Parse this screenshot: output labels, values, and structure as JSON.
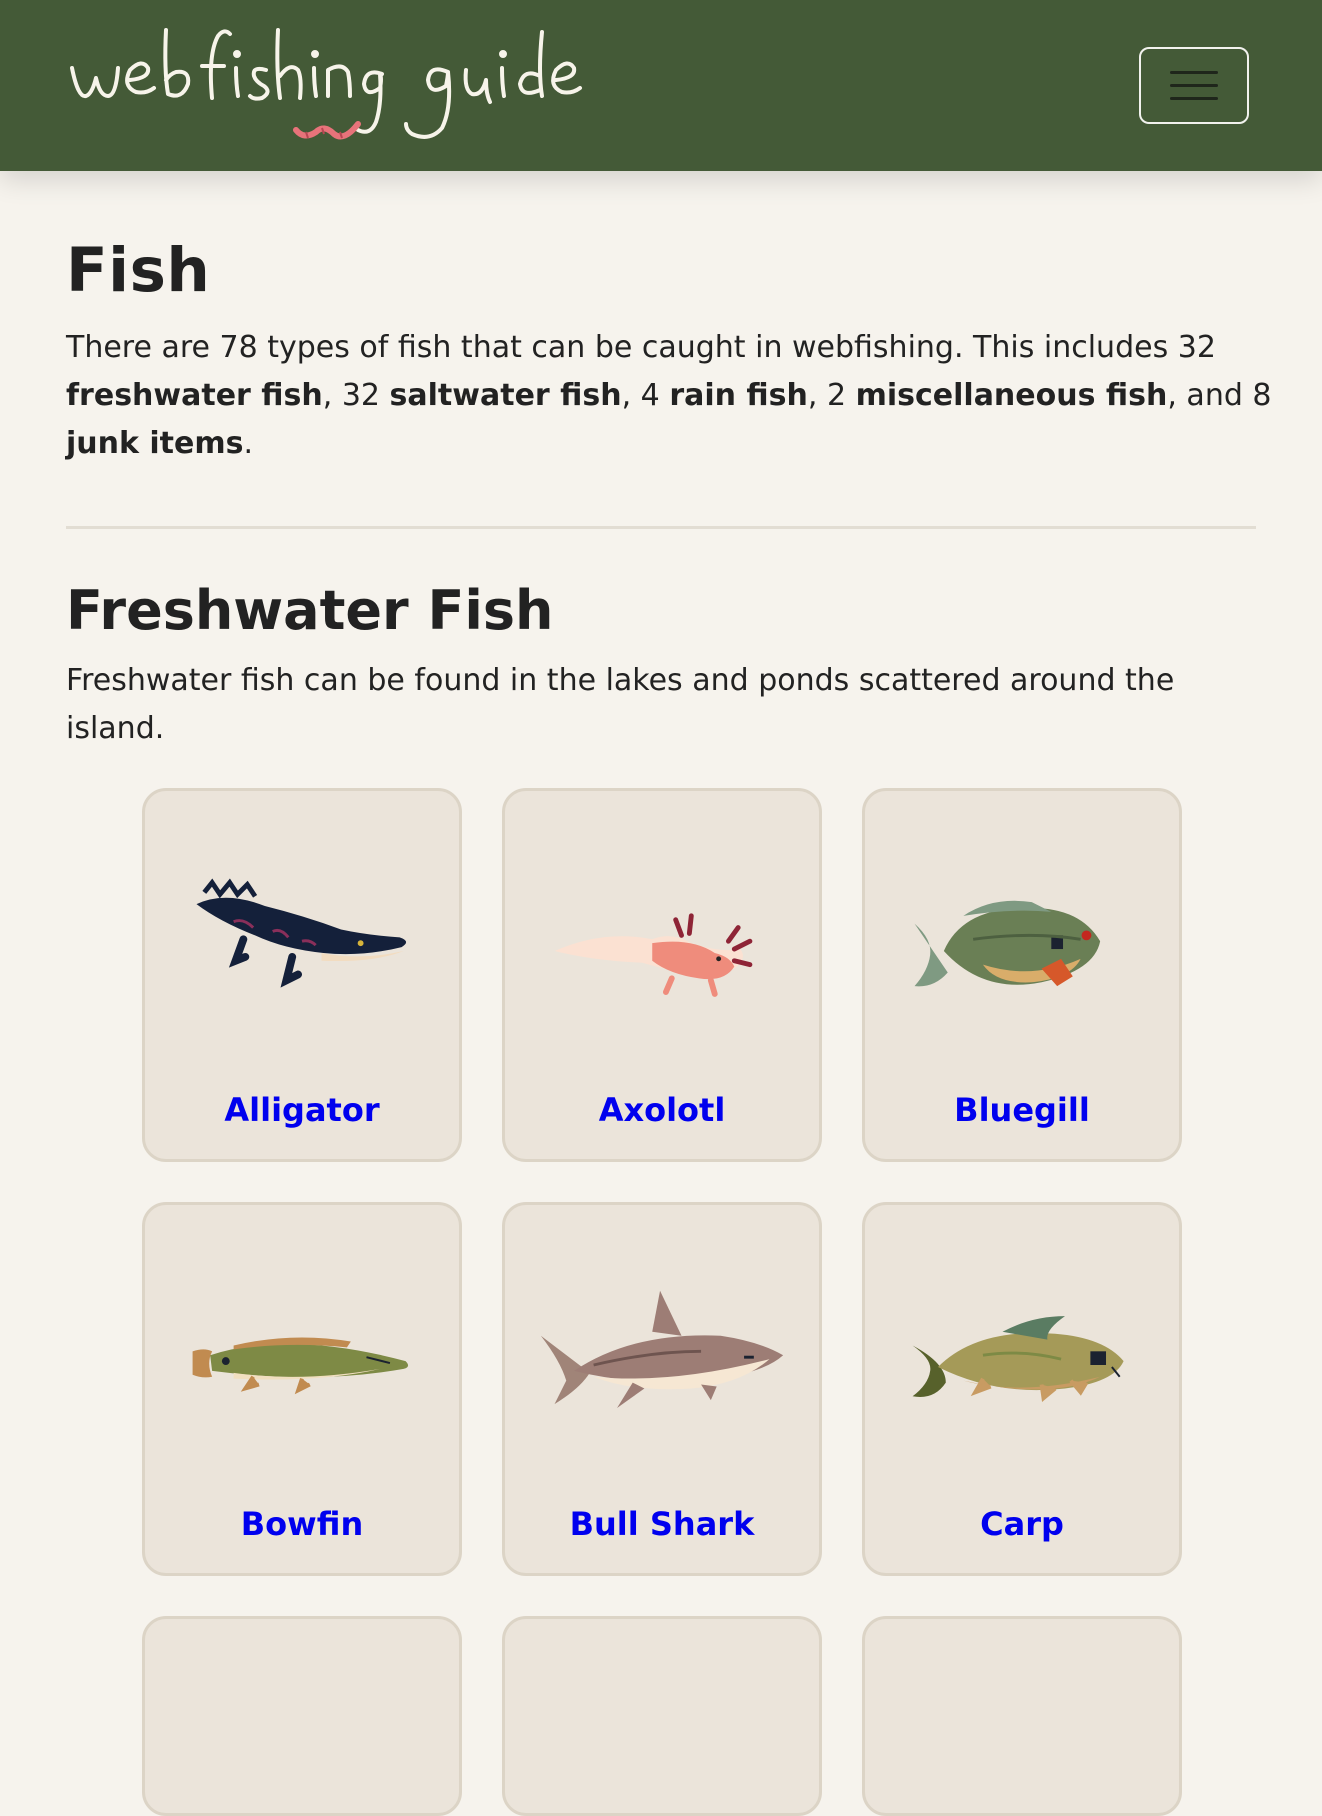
{
  "header": {
    "brand_logo_text": "webfishing guide"
  },
  "page": {
    "title": "Fish",
    "intro": {
      "t1": "There are 78 types of fish that can be caught in webfishing. This includes 32 ",
      "b1": "freshwater fish",
      "t2": ", 32 ",
      "b2": "saltwater fish",
      "t3": ", 4 ",
      "b3": "rain fish",
      "t4": ", 2 ",
      "b4": "miscellaneous fish",
      "t5": ", and 8 ",
      "b5": "junk items",
      "t6": "."
    }
  },
  "freshwater": {
    "title": "Freshwater Fish",
    "description": "Freshwater fish can be found in the lakes and ponds scattered around the island.",
    "fish": [
      {
        "name": "Alligator",
        "icon": "alligator-icon"
      },
      {
        "name": "Axolotl",
        "icon": "axolotl-icon"
      },
      {
        "name": "Bluegill",
        "icon": "bluegill-icon"
      },
      {
        "name": "Bowfin",
        "icon": "bowfin-icon"
      },
      {
        "name": "Bull Shark",
        "icon": "bull-shark-icon"
      },
      {
        "name": "Carp",
        "icon": "carp-icon"
      }
    ]
  },
  "colors": {
    "navbar": "#445a37",
    "page_background": "#f6f3ed",
    "card_background": "#ebe4da",
    "card_border": "#dcd4c6"
  }
}
